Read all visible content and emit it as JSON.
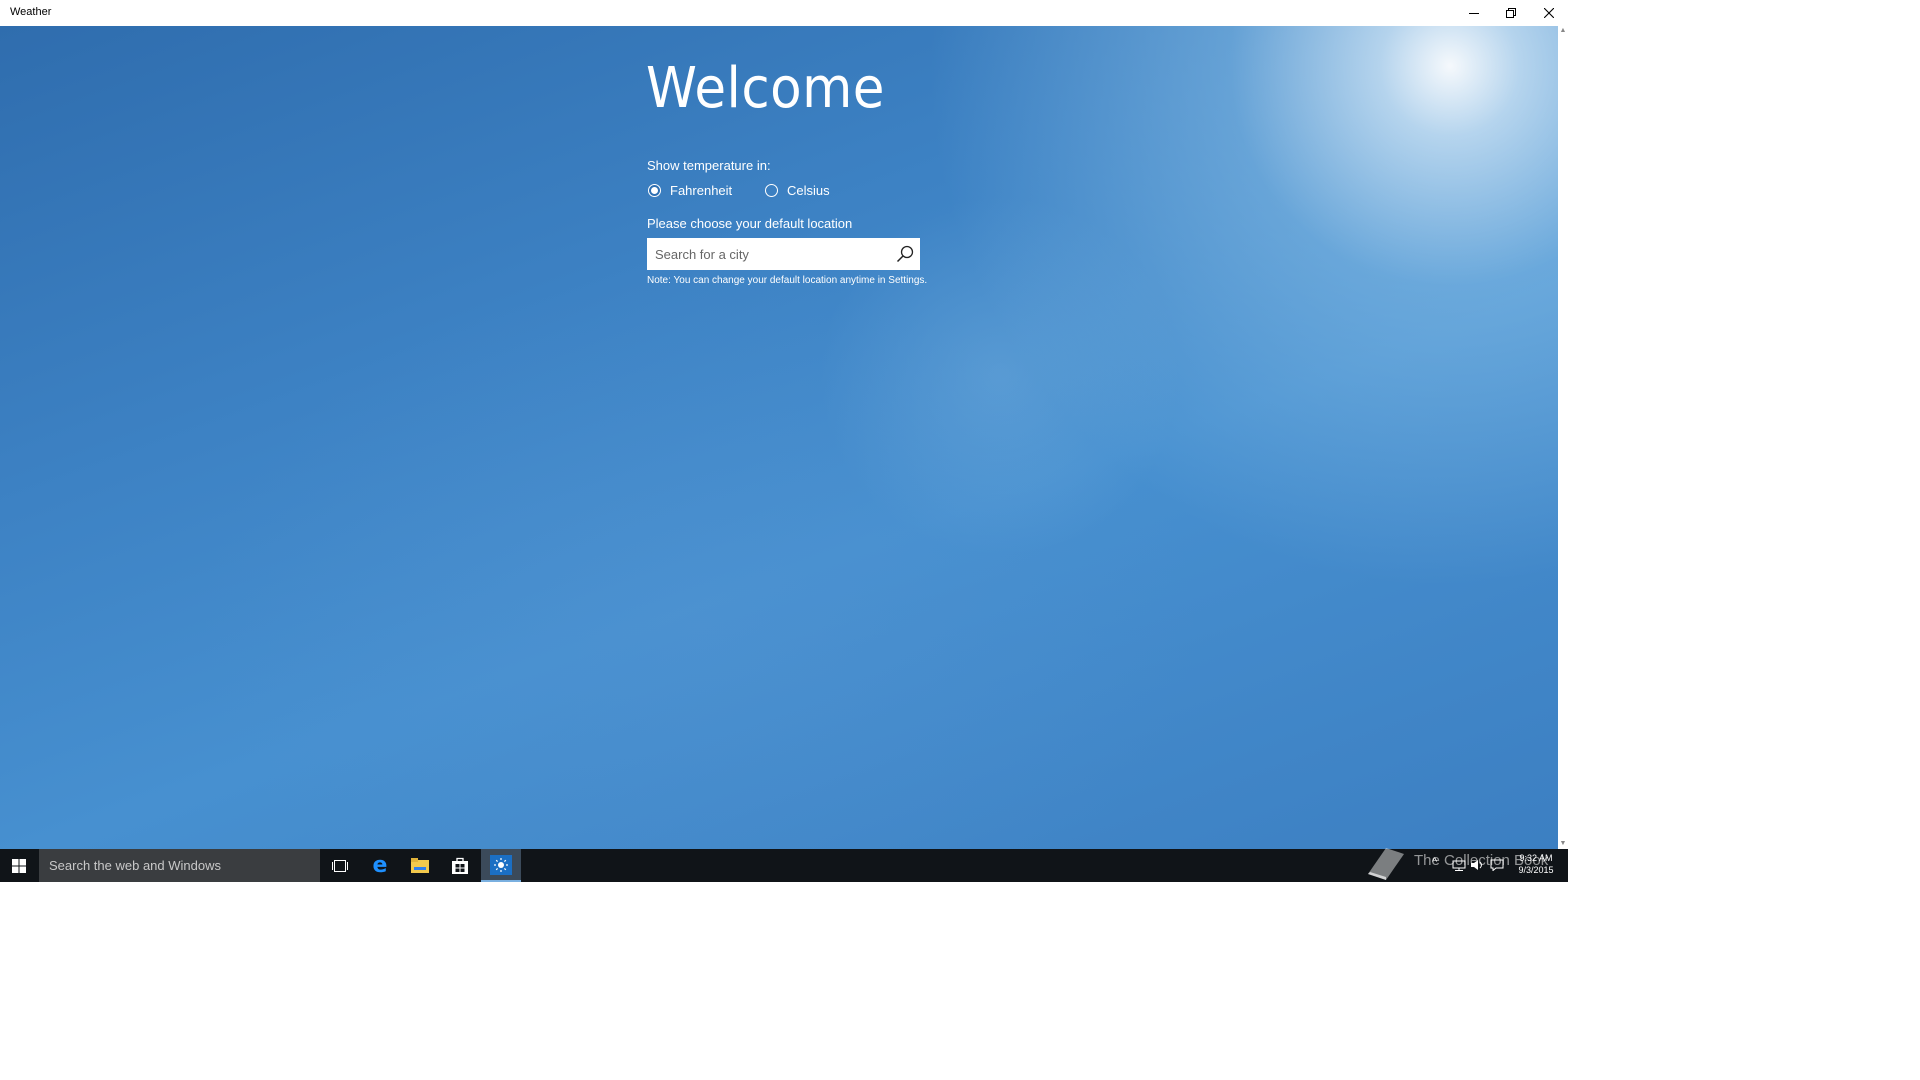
{
  "window": {
    "title": "Weather"
  },
  "welcome": {
    "heading": "Welcome",
    "temperature_label": "Show temperature in:",
    "units": [
      {
        "label": "Fahrenheit",
        "selected": true
      },
      {
        "label": "Celsius",
        "selected": false
      }
    ],
    "location_label": "Please choose your default location",
    "search_placeholder": "Search for a city",
    "note": "Note: You can change your default location anytime in Settings."
  },
  "taskbar": {
    "search_placeholder": "Search the web and Windows",
    "pinned": [
      "task-view-icon",
      "edge-icon",
      "file-explorer-icon",
      "store-icon",
      "weather-icon"
    ],
    "active_app": "weather-icon",
    "watermark": "The Collection Book",
    "clock_time": "9:32 AM",
    "clock_date": "9/3/2015"
  },
  "colors": {
    "background": "#3d82c4",
    "taskbar": "#101418",
    "accent": "#2d6fb3"
  }
}
